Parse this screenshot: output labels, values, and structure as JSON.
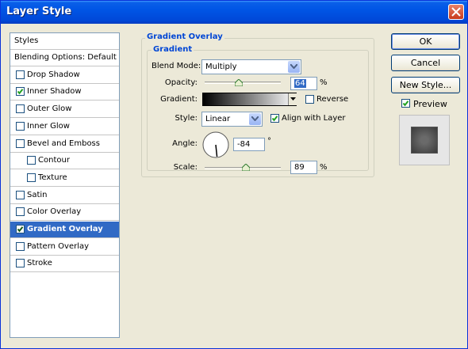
{
  "window": {
    "title": "Layer Style"
  },
  "styles_list": {
    "header": "Styles",
    "items": [
      {
        "label": "Blending Options: Default",
        "checkbox": false,
        "checked": false,
        "indent": false,
        "selected": false
      },
      {
        "label": "Drop Shadow",
        "checkbox": true,
        "checked": false,
        "indent": false,
        "selected": false
      },
      {
        "label": "Inner Shadow",
        "checkbox": true,
        "checked": true,
        "indent": false,
        "selected": false
      },
      {
        "label": "Outer Glow",
        "checkbox": true,
        "checked": false,
        "indent": false,
        "selected": false
      },
      {
        "label": "Inner Glow",
        "checkbox": true,
        "checked": false,
        "indent": false,
        "selected": false
      },
      {
        "label": "Bevel and Emboss",
        "checkbox": true,
        "checked": false,
        "indent": false,
        "selected": false
      },
      {
        "label": "Contour",
        "checkbox": true,
        "checked": false,
        "indent": true,
        "selected": false
      },
      {
        "label": "Texture",
        "checkbox": true,
        "checked": false,
        "indent": true,
        "selected": false
      },
      {
        "label": "Satin",
        "checkbox": true,
        "checked": false,
        "indent": false,
        "selected": false
      },
      {
        "label": "Color Overlay",
        "checkbox": true,
        "checked": false,
        "indent": false,
        "selected": false
      },
      {
        "label": "Gradient Overlay",
        "checkbox": true,
        "checked": true,
        "indent": false,
        "selected": true
      },
      {
        "label": "Pattern Overlay",
        "checkbox": true,
        "checked": false,
        "indent": false,
        "selected": false
      },
      {
        "label": "Stroke",
        "checkbox": true,
        "checked": false,
        "indent": false,
        "selected": false
      }
    ]
  },
  "gradient_overlay": {
    "group_title": "Gradient Overlay",
    "subgroup_title": "Gradient",
    "blend_mode": {
      "label": "Blend Mode:",
      "value": "Multiply"
    },
    "opacity": {
      "label": "Opacity:",
      "value": "64",
      "unit": "%",
      "level": 0.64
    },
    "gradient": {
      "label": "Gradient:",
      "reverse_label": "Reverse",
      "reverse_checked": false
    },
    "style": {
      "label": "Style:",
      "value": "Linear",
      "align_label": "Align with Layer",
      "align_checked": true
    },
    "angle": {
      "label": "Angle:",
      "value": "-84",
      "unit": "°",
      "degrees": -84
    },
    "scale": {
      "label": "Scale:",
      "value": "89",
      "unit": "%",
      "level": 0.89
    }
  },
  "buttons": {
    "ok": "OK",
    "cancel": "Cancel",
    "new_style": "New Style..."
  },
  "preview": {
    "label": "Preview",
    "checked": true
  },
  "colors": {
    "title_bar": "#0055e5",
    "selected_row": "#316ac5",
    "group_title": "#0046d5",
    "dialog_bg": "#ece9d8"
  }
}
